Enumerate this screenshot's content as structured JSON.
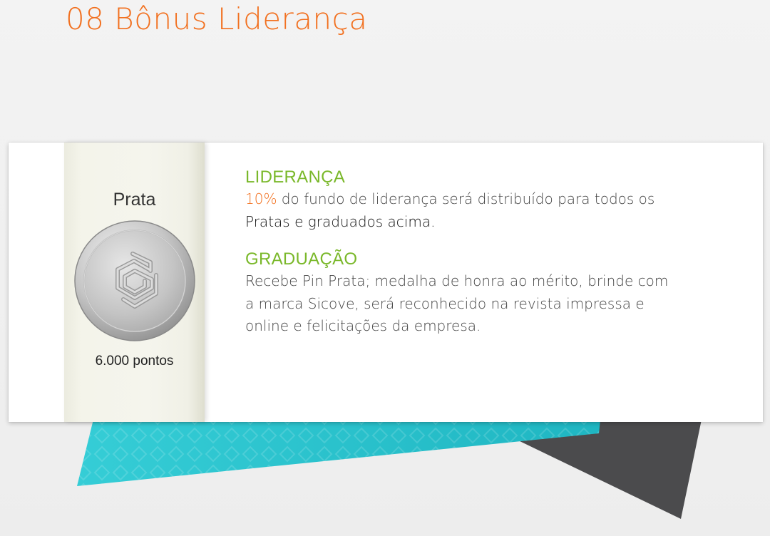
{
  "page": {
    "title": "08 Bônus Liderança"
  },
  "badge": {
    "tier": "Prata",
    "points": "6.000 pontos",
    "icon": "silver-medal-icon"
  },
  "sections": {
    "lideranca": {
      "heading": "LIDERANÇA",
      "highlight": "10%",
      "text_part1": " do fundo de liderança será distribuído para todos os",
      "text_emphasis": "Pratas e graduados acima."
    },
    "graduacao": {
      "heading": "GRADUAÇÃO",
      "text_line1": "Recebe Pin Prata; medalha de honra ao mérito, brinde com",
      "text_line2": "a marca Sicove, será reconhecido na revista impressa e",
      "text_line3": "online e felicitações da empresa."
    }
  },
  "colors": {
    "title": "#f2701f",
    "heading": "#7ab82a",
    "highlight": "#f2701f",
    "teal_shape": "#2bc5cf",
    "gray_shape": "#4a4a4c"
  }
}
